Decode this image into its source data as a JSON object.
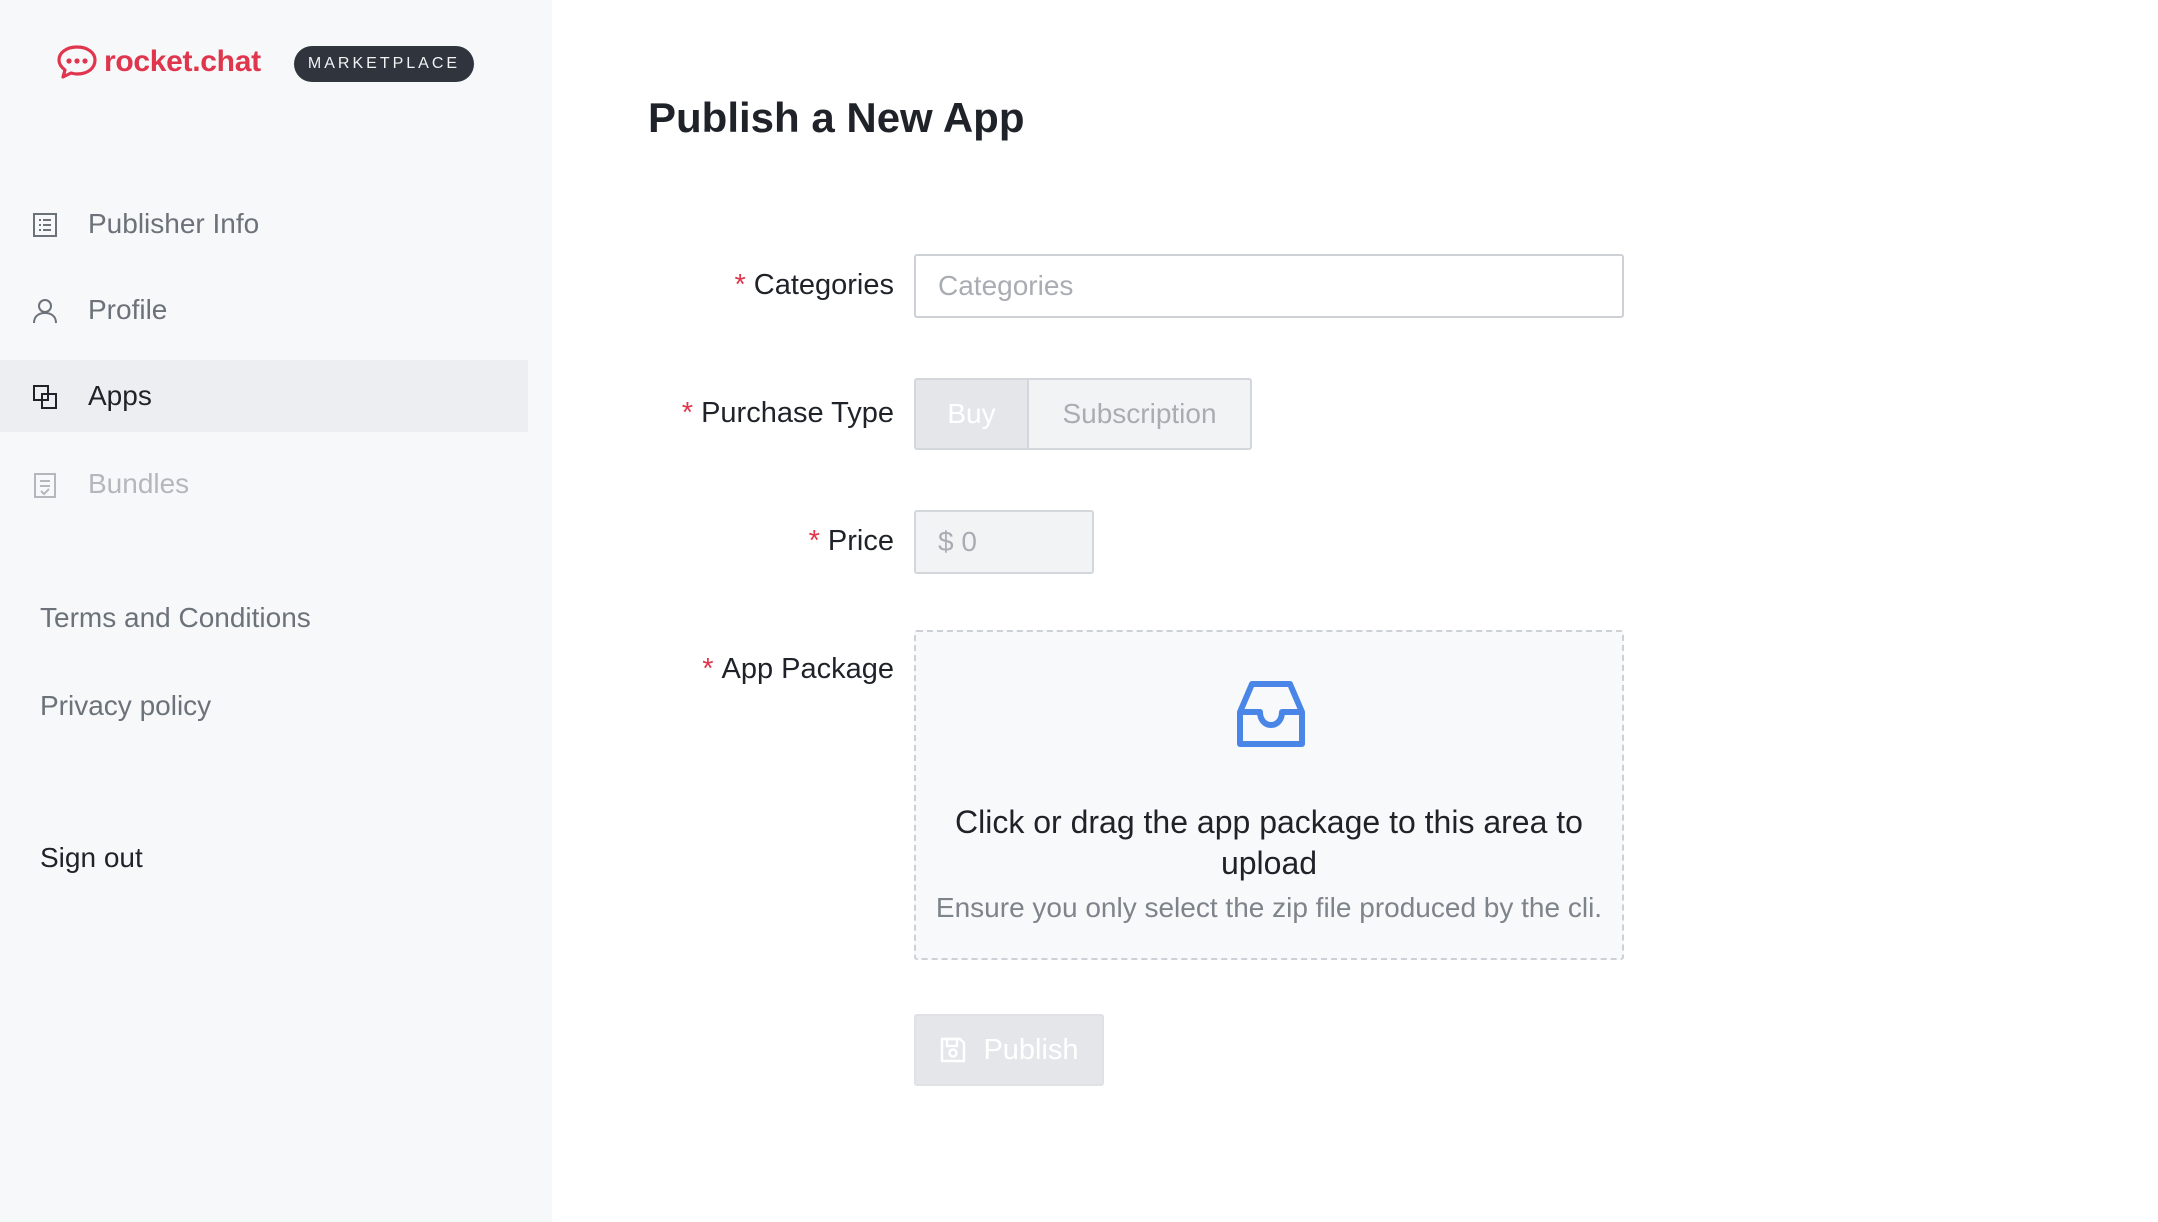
{
  "brand": {
    "logo_text": "rocket.chat",
    "badge": "MARKETPLACE",
    "logo_color": "#e0364d"
  },
  "sidebar": {
    "items": [
      {
        "label": "Publisher Info",
        "icon": "list-icon",
        "state": "normal"
      },
      {
        "label": "Profile",
        "icon": "user-icon",
        "state": "normal"
      },
      {
        "label": "Apps",
        "icon": "apps-icon",
        "state": "active"
      },
      {
        "label": "Bundles",
        "icon": "bundle-icon",
        "state": "disabled"
      }
    ],
    "links": {
      "terms": "Terms and Conditions",
      "privacy": "Privacy policy",
      "signout": "Sign out"
    }
  },
  "main": {
    "title": "Publish a New App",
    "form": {
      "required_mark": "*",
      "categories": {
        "label": "Categories",
        "placeholder": "Categories",
        "value": ""
      },
      "purchase_type": {
        "label": "Purchase Type",
        "options": [
          "Buy",
          "Subscription"
        ],
        "selected": "Buy"
      },
      "price": {
        "label": "Price",
        "placeholder": "$ 0"
      },
      "app_package": {
        "label": "App Package",
        "drop_title": "Click or drag the app package to this area to upload",
        "drop_hint": "Ensure you only select the zip file produced by the cli.",
        "icon": "inbox-icon",
        "icon_color": "#4a86e8"
      },
      "publish_label": "Publish"
    }
  }
}
